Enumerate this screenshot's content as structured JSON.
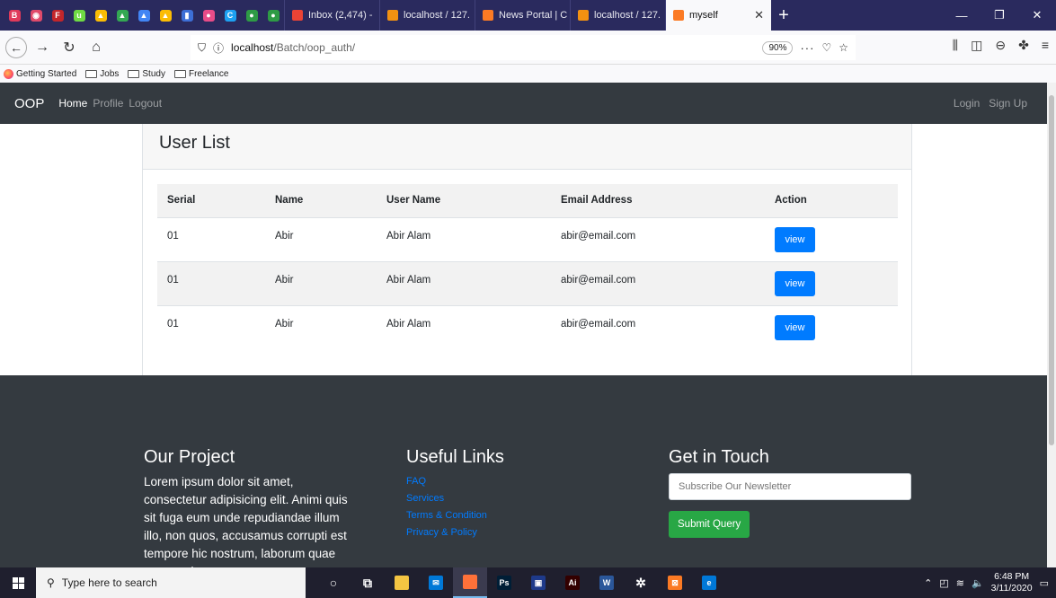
{
  "browser": {
    "pinned_tabs": [
      {
        "icon": "b-app-icon",
        "color": "#e03a5a",
        "glyph": "B"
      },
      {
        "icon": "circle-app-icon",
        "color": "#e04a6a",
        "glyph": "◉"
      },
      {
        "icon": "flash-icon",
        "color": "#c3262b",
        "glyph": "F"
      },
      {
        "icon": "upwork-icon",
        "color": "#6fda44",
        "glyph": "u"
      },
      {
        "icon": "drive-icon",
        "color": "#fbbc04",
        "glyph": "▲"
      },
      {
        "icon": "drive-icon",
        "color": "#34a853",
        "glyph": "▲"
      },
      {
        "icon": "drive-icon",
        "color": "#4285f4",
        "glyph": "▲"
      },
      {
        "icon": "drive-icon",
        "color": "#fbbc04",
        "glyph": "▲"
      },
      {
        "icon": "chart-app-icon",
        "color": "#3d6fd6",
        "glyph": "▮"
      },
      {
        "icon": "pink-app-icon",
        "color": "#e84c88",
        "glyph": "●"
      },
      {
        "icon": "c-app-icon",
        "color": "#1da1f2",
        "glyph": "C"
      },
      {
        "icon": "green-app-icon",
        "color": "#2e9b45",
        "glyph": "●"
      },
      {
        "icon": "green-app-icon",
        "color": "#2e9b45",
        "glyph": "●"
      }
    ],
    "tabs": [
      {
        "title": "Inbox (2,474) -",
        "color": "#ea4335",
        "icon": "gmail-icon"
      },
      {
        "title": "localhost / 127.",
        "color": "#f29111",
        "icon": "phpmyadmin-icon"
      },
      {
        "title": "News Portal | C",
        "color": "#fb7a24",
        "icon": "xampp-icon"
      },
      {
        "title": "localhost / 127.",
        "color": "#f29111",
        "icon": "phpmyadmin-icon"
      },
      {
        "title": "myself",
        "color": "#fb7a24",
        "icon": "xampp-icon",
        "active": true
      }
    ],
    "url_host": "localhost",
    "url_path": "/Batch/oop_auth/",
    "zoom": "90%",
    "bookmarks": [
      {
        "label": "Getting Started",
        "type": "firefox"
      },
      {
        "label": "Jobs",
        "type": "folder"
      },
      {
        "label": "Study",
        "type": "folder"
      },
      {
        "label": "Freelance",
        "type": "folder"
      }
    ]
  },
  "site": {
    "brand": "OOP",
    "nav": [
      "Home",
      "Profile",
      "Logout"
    ],
    "nav_right": [
      "Login",
      "Sign Up"
    ],
    "card_title": "User List",
    "table_headers": [
      "Serial",
      "Name",
      "User Name",
      "Email Address",
      "Action"
    ],
    "rows": [
      {
        "serial": "01",
        "name": "Abir",
        "username": "Abir Alam",
        "email": "abir@email.com",
        "action": "view"
      },
      {
        "serial": "01",
        "name": "Abir",
        "username": "Abir Alam",
        "email": "abir@email.com",
        "action": "view"
      },
      {
        "serial": "01",
        "name": "Abir",
        "username": "Abir Alam",
        "email": "abir@email.com",
        "action": "view"
      }
    ]
  },
  "footer": {
    "project_title": "Our Project",
    "project_text": "Lorem ipsum dolor sit amet, consectetur adipisicing elit. Animi quis sit fuga eum unde repudiandae illum illo, non quos, accusamus corrupti est tempore hic nostrum, laborum quae praesentium",
    "links_title": "Useful Links",
    "links": [
      "FAQ",
      "Services",
      "Terms & Condition",
      "Privacy & Policy"
    ],
    "contact_title": "Get in Touch",
    "newsletter_placeholder": "Subscribe Our Newsletter",
    "submit_label": "Submit Query"
  },
  "taskbar": {
    "search_placeholder": "Type here to search",
    "apps": [
      {
        "icon": "cortana-icon",
        "color": "transparent",
        "glyph": "○"
      },
      {
        "icon": "task-view-icon",
        "color": "transparent",
        "glyph": "⧉"
      },
      {
        "icon": "file-explorer-icon",
        "color": "#f4c542",
        "glyph": ""
      },
      {
        "icon": "mail-icon",
        "color": "#0078d7",
        "glyph": "✉"
      },
      {
        "icon": "firefox-icon",
        "color": "#ff7139",
        "glyph": "",
        "active": true
      },
      {
        "icon": "photoshop-icon",
        "color": "#001e36",
        "glyph": "Ps"
      },
      {
        "icon": "app-icon",
        "color": "#1e3a8a",
        "glyph": "▣"
      },
      {
        "icon": "illustrator-icon",
        "color": "#330000",
        "glyph": "Ai"
      },
      {
        "icon": "word-icon",
        "color": "#2b579a",
        "glyph": "W"
      },
      {
        "icon": "settings-icon",
        "color": "transparent",
        "glyph": "✲"
      },
      {
        "icon": "xampp-icon",
        "color": "#fb7a24",
        "glyph": "⊠"
      },
      {
        "icon": "edge-icon",
        "color": "#0078d7",
        "glyph": "e"
      }
    ],
    "time": "6:48 PM",
    "date": "3/11/2020"
  }
}
